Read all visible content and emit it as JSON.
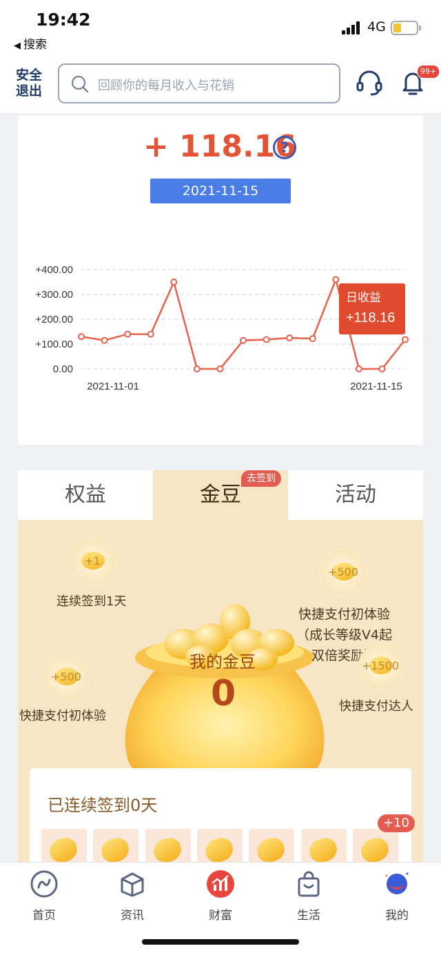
{
  "status_bar": {
    "time": "19:42",
    "back_label": "搜索",
    "network": "4G"
  },
  "header": {
    "logout_label": "安全退出",
    "search_placeholder": "回顾你的每月收入与花销",
    "notification_badge": "99+"
  },
  "earnings": {
    "amount": "+ 118.16",
    "help_symbol": "?",
    "date": "2021-11-15"
  },
  "chart_data": {
    "type": "line",
    "x": [
      "2021-11-01",
      "2021-11-02",
      "2021-11-03",
      "2021-11-04",
      "2021-11-05",
      "2021-11-06",
      "2021-11-07",
      "2021-11-08",
      "2021-11-09",
      "2021-11-10",
      "2021-11-11",
      "2021-11-12",
      "2021-11-13",
      "2021-11-14",
      "2021-11-15"
    ],
    "values": [
      130,
      115,
      140,
      140,
      350,
      0,
      0,
      115,
      118,
      125,
      122,
      360,
      0,
      0,
      118.16
    ],
    "y_ticks": [
      "+400.00",
      "+300.00",
      "+200.00",
      "+100.00",
      "0.00"
    ],
    "x_tick_labels": [
      "2021-11-01",
      "2021-11-15"
    ],
    "ylim": [
      0,
      400
    ],
    "grid": true,
    "line_color": "#e8604a",
    "tooltip": {
      "title": "日收益",
      "value": "+118.16"
    }
  },
  "tabs": [
    {
      "label": "权益"
    },
    {
      "label": "金豆"
    },
    {
      "label": "活动"
    }
  ],
  "sign_badge": "去签到",
  "gold": {
    "bag_label": "我的金豆",
    "bag_value": "0",
    "rewards": [
      {
        "coin": "+1",
        "label": "连续签到1天"
      },
      {
        "coin": "+500",
        "label": "快捷支付初体验\n（成长等级V4起\n双倍奖励）"
      },
      {
        "coin": "+500",
        "label": "快捷支付初体验"
      },
      {
        "coin": "+1500",
        "label": "快捷支付达人"
      }
    ],
    "streak_title": "已连续签到0天",
    "streak_bonus": "+10"
  },
  "bottom_nav": [
    {
      "label": "首页"
    },
    {
      "label": "资讯"
    },
    {
      "label": "财富"
    },
    {
      "label": "生活"
    },
    {
      "label": "我的"
    }
  ],
  "colors": {
    "accent_red": "#e35336",
    "blue": "#4a7de6",
    "gold_bg": "#f6e6c6"
  }
}
